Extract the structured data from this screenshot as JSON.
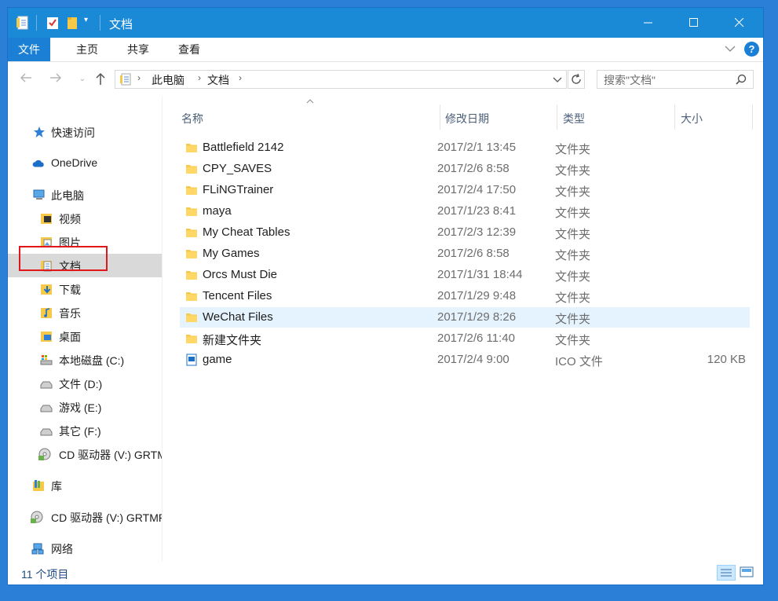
{
  "window": {
    "title": "文档"
  },
  "ribbon": {
    "tabs": [
      "文件",
      "主页",
      "共享",
      "查看"
    ]
  },
  "address": {
    "crumbs": [
      "此电脑",
      "文档"
    ]
  },
  "search": {
    "placeholder": "搜索\"文档\""
  },
  "sidebar": {
    "quick_access": "快速访问",
    "onedrive": "OneDrive",
    "this_pc": "此电脑",
    "pc_items": [
      "视频",
      "图片",
      "文档",
      "下载",
      "音乐",
      "桌面",
      "本地磁盘 (C:)",
      "文件 (D:)",
      "游戏 (E:)",
      "其它 (F:)",
      "CD 驱动器 (V:) GRTMP"
    ],
    "library": "库",
    "cd_drive": "CD 驱动器 (V:) GRTMP",
    "network": "网络",
    "selected": "文档"
  },
  "columns": {
    "name": "名称",
    "date": "修改日期",
    "type": "类型",
    "size": "大小"
  },
  "files": [
    {
      "name": "Battlefield 2142",
      "date": "2017/2/1 13:45",
      "type": "文件夹",
      "size": "",
      "icon": "folder-icon"
    },
    {
      "name": "CPY_SAVES",
      "date": "2017/2/6 8:58",
      "type": "文件夹",
      "size": "",
      "icon": "folder-icon"
    },
    {
      "name": "FLiNGTrainer",
      "date": "2017/2/4 17:50",
      "type": "文件夹",
      "size": "",
      "icon": "folder-icon"
    },
    {
      "name": "maya",
      "date": "2017/1/23 8:41",
      "type": "文件夹",
      "size": "",
      "icon": "folder-icon"
    },
    {
      "name": "My Cheat Tables",
      "date": "2017/2/3 12:39",
      "type": "文件夹",
      "size": "",
      "icon": "folder-icon"
    },
    {
      "name": "My Games",
      "date": "2017/2/6 8:58",
      "type": "文件夹",
      "size": "",
      "icon": "folder-icon"
    },
    {
      "name": "Orcs Must Die",
      "date": "2017/1/31 18:44",
      "type": "文件夹",
      "size": "",
      "icon": "folder-icon"
    },
    {
      "name": "Tencent Files",
      "date": "2017/1/29 9:48",
      "type": "文件夹",
      "size": "",
      "icon": "folder-icon"
    },
    {
      "name": "WeChat Files",
      "date": "2017/1/29 8:26",
      "type": "文件夹",
      "size": "",
      "icon": "folder-icon"
    },
    {
      "name": "新建文件夹",
      "date": "2017/2/6 11:40",
      "type": "文件夹",
      "size": "",
      "icon": "folder-icon"
    },
    {
      "name": "game",
      "date": "2017/2/4 9:00",
      "type": "ICO 文件",
      "size": "120 KB",
      "icon": "image-file-icon"
    }
  ],
  "status": {
    "item_count": "11 个项目"
  },
  "colors": {
    "titlebar": "#1a8ad7",
    "accent": "#1a7fd5",
    "hover_row": "#e5f3ff",
    "selected_nav": "#d9d9d9",
    "highlight_box": "#e0161b"
  }
}
